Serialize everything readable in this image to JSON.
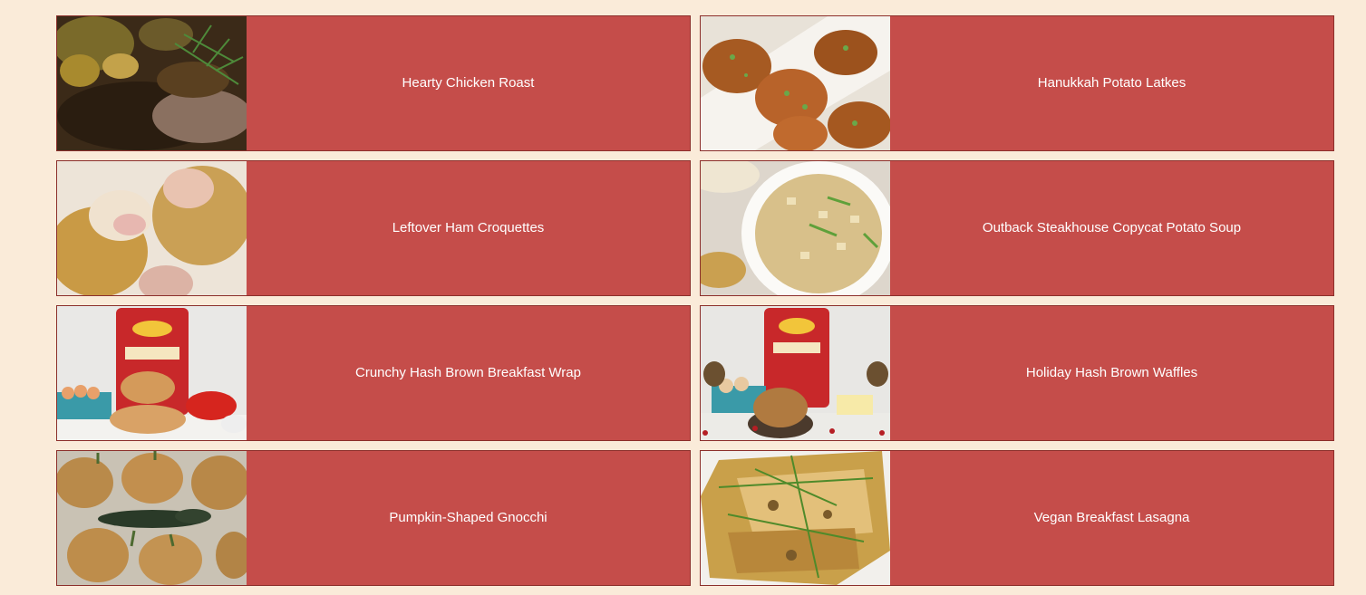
{
  "recipes": [
    {
      "title": "Hearty Chicken Roast",
      "image": "chicken-roast-photo"
    },
    {
      "title": "Hanukkah Potato Latkes",
      "image": "potato-latkes-photo"
    },
    {
      "title": "Leftover Ham Croquettes",
      "image": "ham-croquettes-photo"
    },
    {
      "title": "Outback Steakhouse Copycat Potato Soup",
      "image": "potato-soup-photo"
    },
    {
      "title": "Crunchy Hash Brown Breakfast Wrap",
      "image": "hash-brown-wrap-photo"
    },
    {
      "title": "Holiday Hash Brown Waffles",
      "image": "hash-brown-waffles-photo"
    },
    {
      "title": "Pumpkin-Shaped Gnocchi",
      "image": "pumpkin-gnocchi-photo"
    },
    {
      "title": "Vegan Breakfast Lasagna",
      "image": "vegan-lasagna-photo"
    }
  ],
  "colors": {
    "page_background": "#faebd9",
    "card_background": "#c54d4a",
    "card_border": "#8c2f2b",
    "title_text": "#ffffff"
  }
}
